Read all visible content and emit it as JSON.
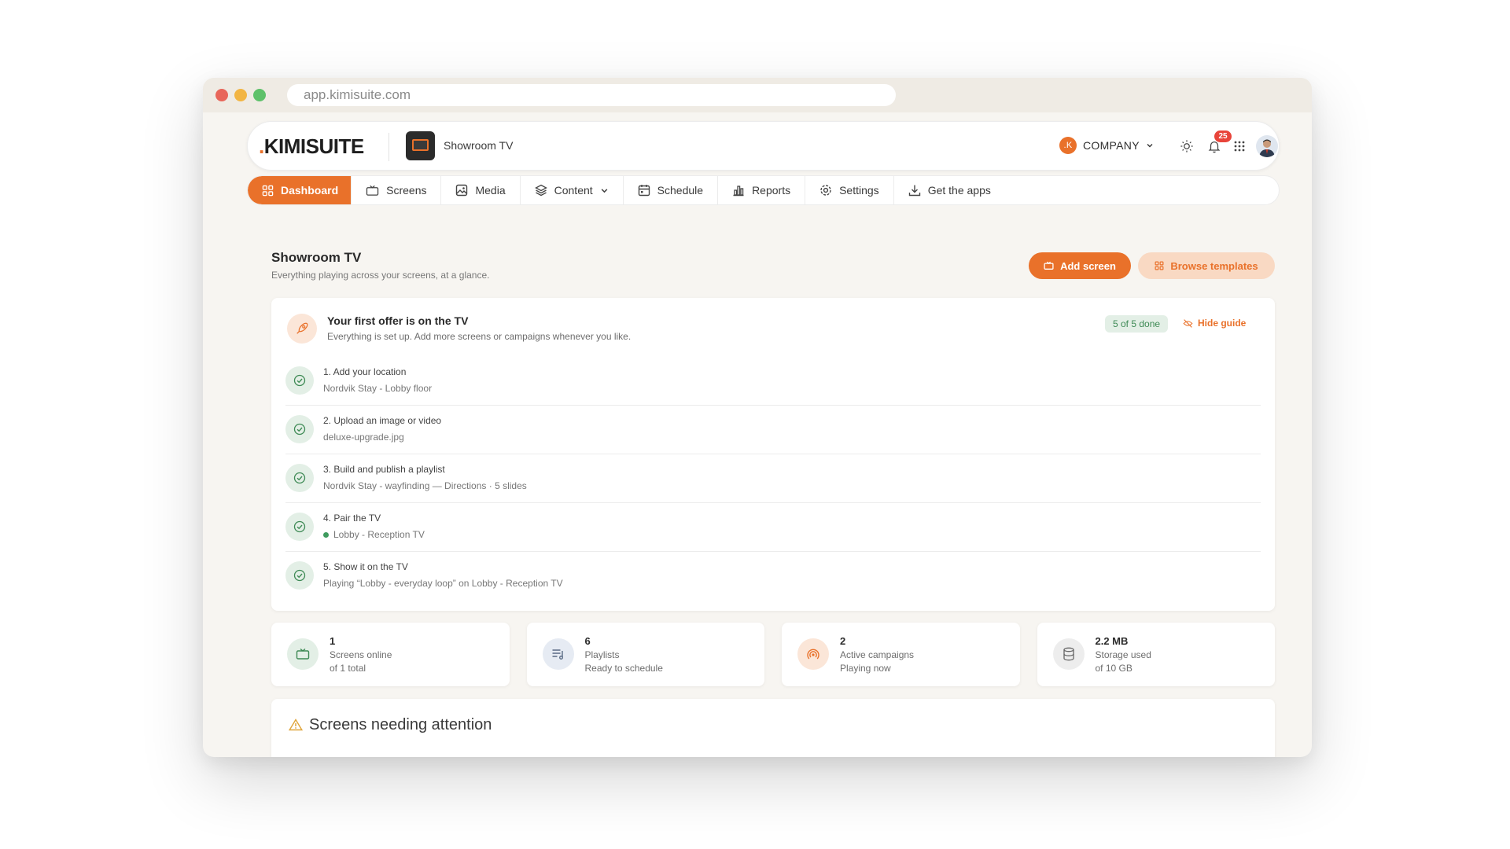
{
  "browser": {
    "url": "app.kimisuite.com"
  },
  "topbar": {
    "logo": "KIMISUITE",
    "screen_name": "Showroom TV",
    "company_initial": ".K",
    "company_label": "COMPANY",
    "notifications": "25"
  },
  "nav": {
    "items": [
      {
        "label": "Dashboard",
        "icon": "dashboard-icon"
      },
      {
        "label": "Screens",
        "icon": "tv-icon"
      },
      {
        "label": "Media",
        "icon": "image-icon"
      },
      {
        "label": "Content",
        "icon": "layers-icon"
      },
      {
        "label": "Schedule",
        "icon": "calendar-icon"
      },
      {
        "label": "Reports",
        "icon": "bar-chart-icon"
      },
      {
        "label": "Settings",
        "icon": "gear-icon"
      },
      {
        "label": "Get the apps",
        "icon": "download-icon"
      }
    ]
  },
  "page": {
    "title": "Showroom TV",
    "subtitle": "Everything playing across your screens, at a glance.",
    "add_screen": "Add screen",
    "browse_templates": "Browse templates"
  },
  "guide": {
    "title": "Your first offer is on the TV",
    "subtitle": "Everything is set up. Add more screens or campaigns whenever you like.",
    "progress": "5 of 5 done",
    "hide": "Hide guide",
    "steps": [
      {
        "title": "1. Add your location",
        "detail": "Nordvik Stay - Lobby floor"
      },
      {
        "title": "2. Upload an image or video",
        "detail": "deluxe-upgrade.jpg"
      },
      {
        "title": "3. Build and publish a playlist",
        "detail": "Nordvik Stay - wayfinding — Directions · 5 slides"
      },
      {
        "title": "4. Pair the TV",
        "detail": "Lobby - Reception TV"
      },
      {
        "title": "5. Show it on the TV",
        "detail": "Playing “Lobby - everyday loop” on Lobby - Reception TV"
      }
    ]
  },
  "stats": [
    {
      "value": "1",
      "label": "Screens online",
      "sub": "of 1 total",
      "icon": "tv-icon",
      "color": "#e3efe6"
    },
    {
      "value": "6",
      "label": "Playlists",
      "sub": "Ready to schedule",
      "icon": "playlist-icon",
      "color": "#e6ebf3"
    },
    {
      "value": "2",
      "label": "Active campaigns",
      "sub": "Playing now",
      "icon": "broadcast-icon",
      "color": "#fbe6d8"
    },
    {
      "value": "2.2 MB",
      "label": "Storage used",
      "sub": "of 10 GB",
      "icon": "database-icon",
      "color": "#ededed"
    }
  ],
  "attention": {
    "title": "Screens needing attention"
  },
  "colors": {
    "accent": "#e9712a",
    "success": "#3e8a55",
    "danger": "#e8443a"
  }
}
